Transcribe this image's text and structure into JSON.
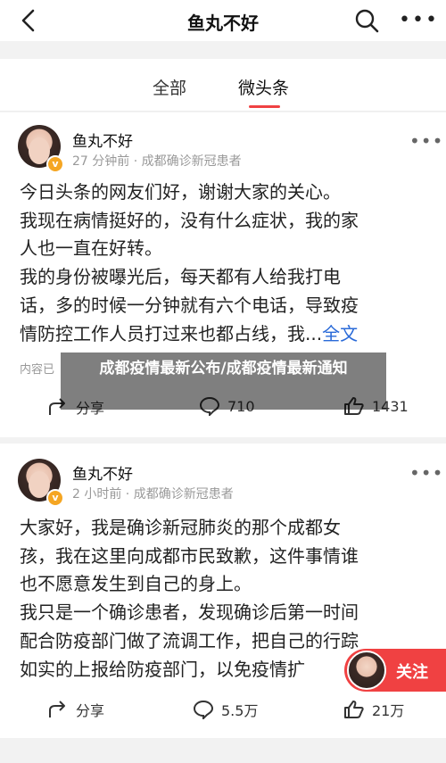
{
  "nav": {
    "title": "鱼丸不好"
  },
  "tabs": [
    {
      "label": "全部"
    },
    {
      "label": "微头条"
    }
  ],
  "posts": [
    {
      "author": "鱼丸不好",
      "meta": "27 分钟前 · 成都确诊新冠患者",
      "lines": [
        "今日头条的网友们好，谢谢大家的关心。",
        "我现在病情挺好的，没有什么症状，我的家",
        "人也一直在好转。",
        "我的身份被曝光后，每天都有人给我打电",
        "话，多的时候一分钟就有六个电话，导致疫",
        "情防控工作人员打过来也都占线，我..."
      ],
      "fulltext_label": "全文",
      "inner_hint": "内容已",
      "share_label": "分享",
      "comment_count": "710",
      "like_count": "1431"
    },
    {
      "author": "鱼丸不好",
      "meta": "2 小时前 · 成都确诊新冠患者",
      "lines": [
        "大家好，我是确诊新冠肺炎的那个成都女",
        "孩，我在这里向成都市民致歉，这件事情谁",
        "也不愿意发生到自己的身上。",
        "我只是一个确诊患者，发现确诊后第一时间",
        "配合防疫部门做了流调工作，把自己的行踪",
        "如实的上报给防疫部门，以免疫情扩"
      ],
      "share_label": "分享",
      "comment_count": "5.5万",
      "like_count": "21万"
    }
  ],
  "overlay_caption": "成都疫情最新公布/成都疫情最新通知",
  "follow_button": {
    "label": "关注"
  },
  "colors": {
    "accent": "#f04142",
    "link": "#2a6ad8",
    "badge": "#f5a623"
  }
}
